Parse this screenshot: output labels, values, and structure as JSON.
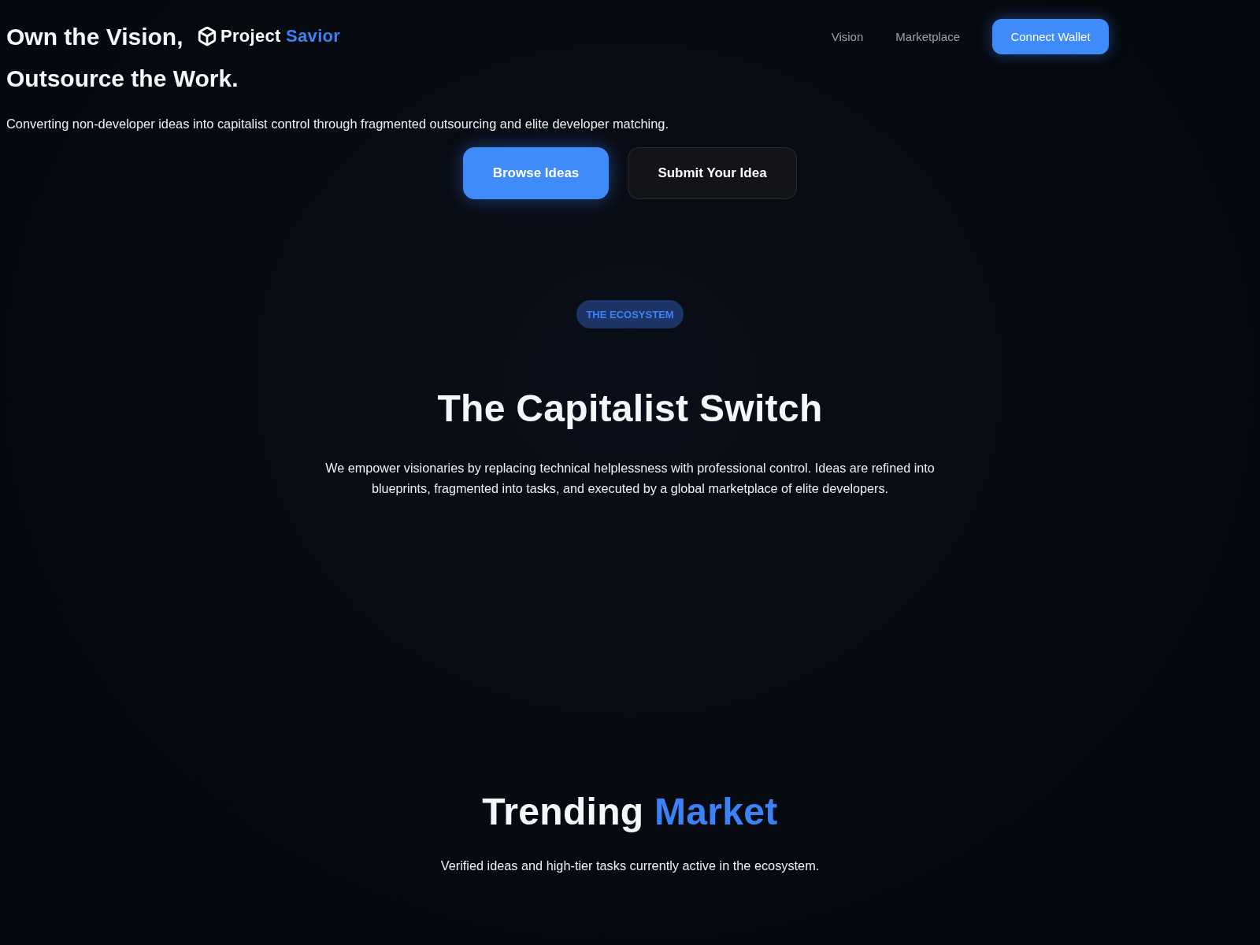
{
  "nav": {
    "brand": {
      "text": "Project",
      "accent": "Savior"
    },
    "links": [
      "Vision",
      "Marketplace"
    ],
    "cta": "Connect Wallet"
  },
  "hero": {
    "title_lines": [
      "Own the Vision,",
      "Outsource the Work."
    ],
    "subtitle": "Converting non-developer ideas into capitalist control through fragmented outsourcing and elite developer matching.",
    "buttons": [
      {
        "label": "Browse Ideas",
        "kind": "primary"
      },
      {
        "label": "Submit Your Idea",
        "kind": "secondary"
      }
    ]
  },
  "ecosystem": {
    "badge": "THE ECOSYSTEM",
    "title": "The Capitalist Switch",
    "body": "We empower visionaries by replacing technical helplessness with professional control. Ideas are refined into blueprints, fragmented into tasks, and executed by a global marketplace of elite developers."
  },
  "trending": {
    "title": "Trending",
    "accent": "Market",
    "subtitle": "Verified ideas and high-tier tasks currently active in the ecosystem."
  }
}
